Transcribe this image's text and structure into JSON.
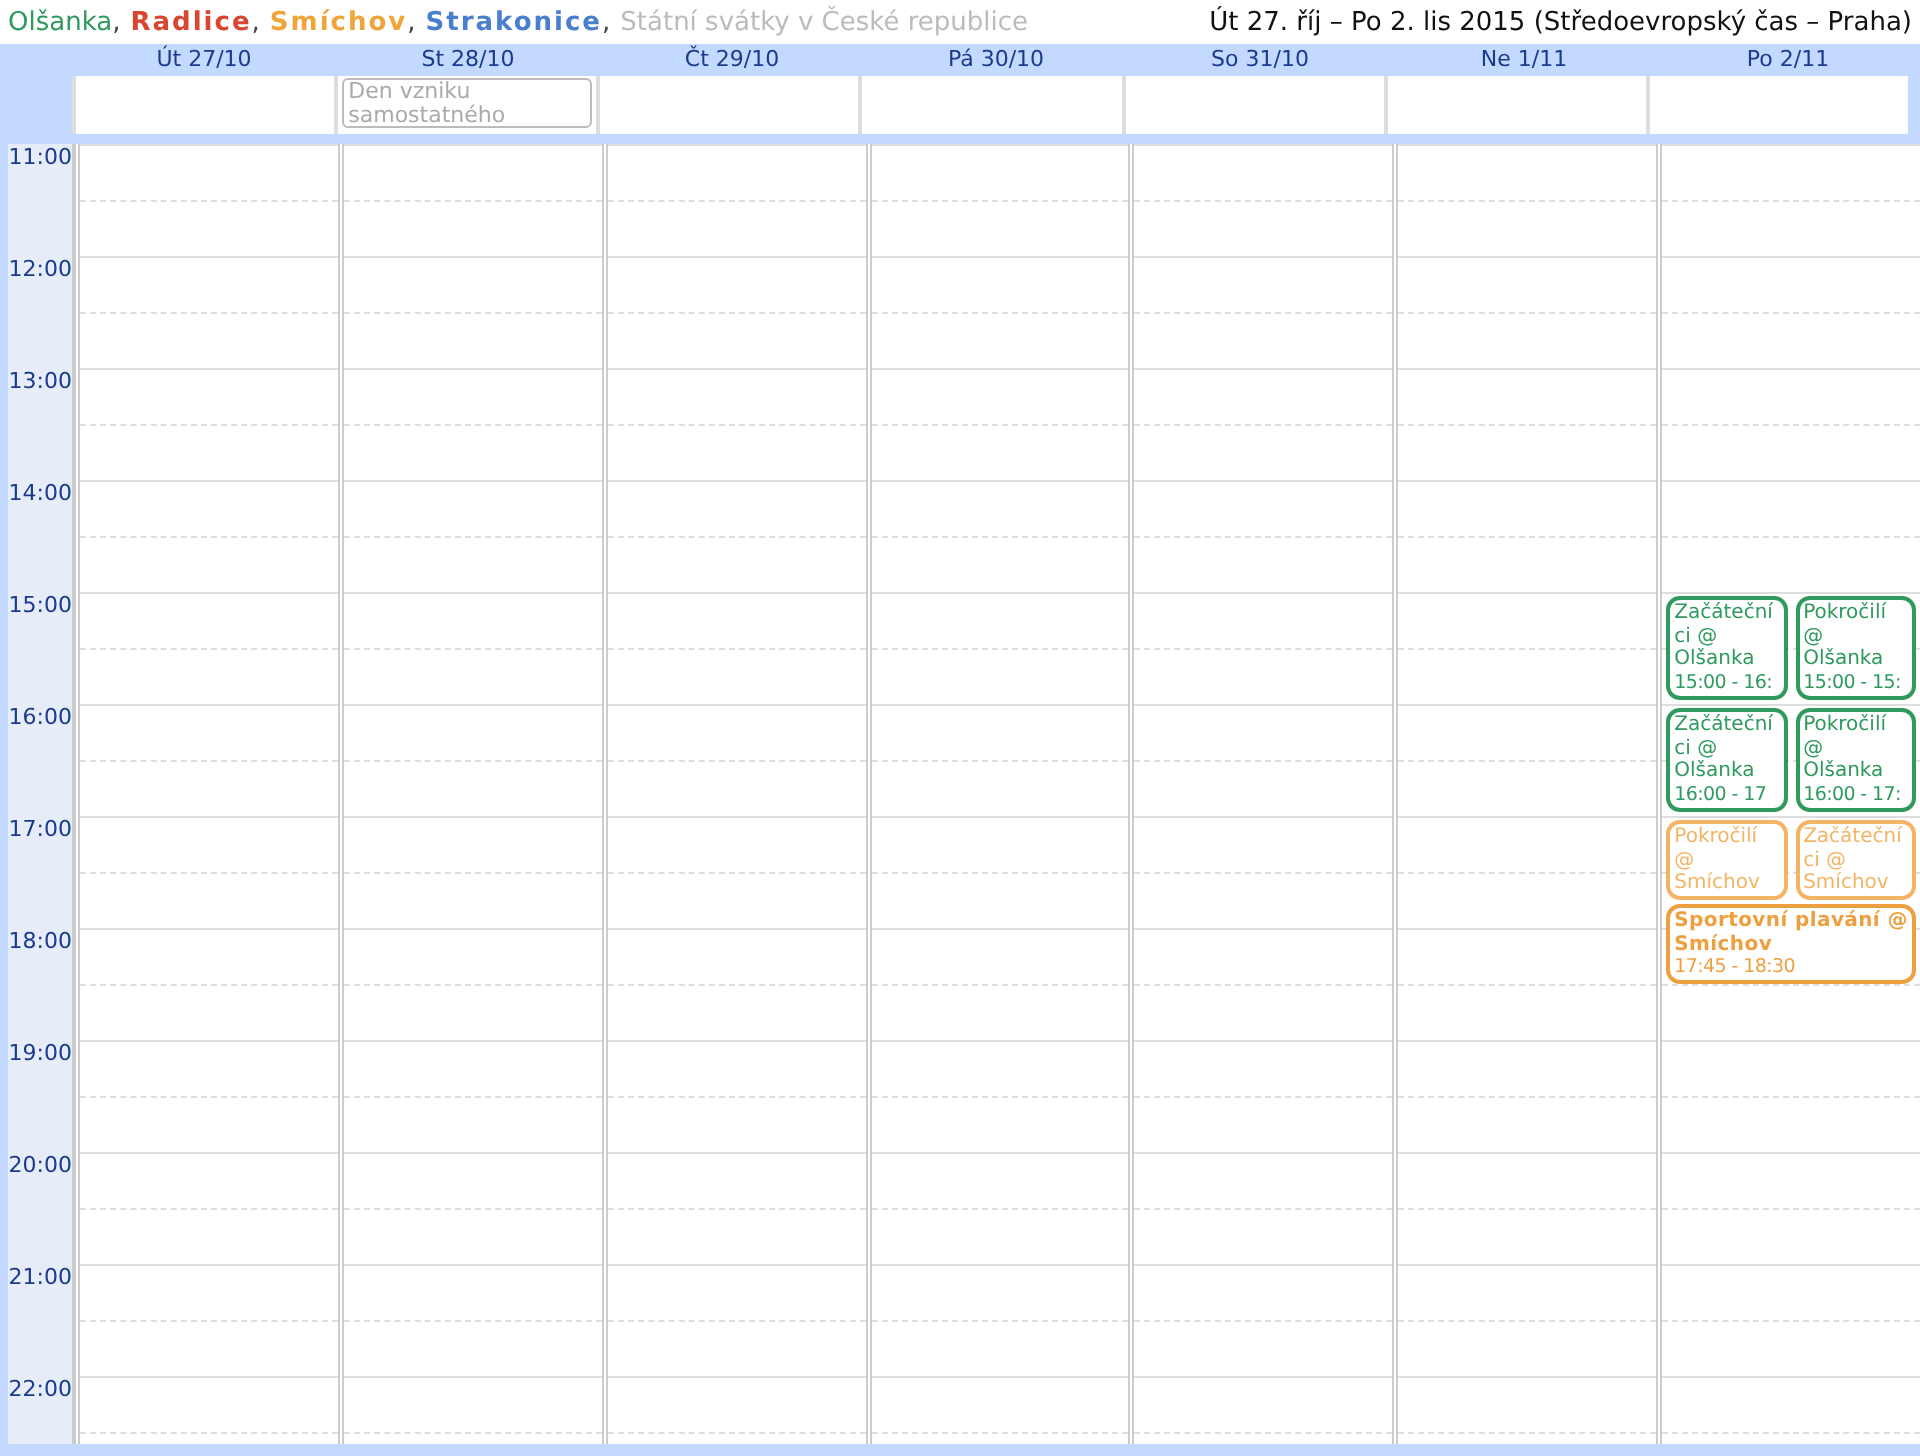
{
  "calendars": [
    {
      "name": "Olšanka",
      "suffix": ",",
      "color": "#2e9a5e",
      "bold": false
    },
    {
      "name": "Radlice",
      "suffix": ",",
      "color": "#d9452f",
      "bold": true
    },
    {
      "name": "Smíchov",
      "suffix": ",",
      "color": "#f0a53a",
      "bold": true
    },
    {
      "name": "Strakonice",
      "suffix": ",",
      "color": "#4a7fcf",
      "bold": true
    },
    {
      "name": "Státní svátky v České republice",
      "color": "#bbbbbb",
      "bold": false
    }
  ],
  "date_range": "Út 27. říj – Po 2. lis 2015 (Středoevropský čas – Praha)",
  "days": [
    {
      "label": "Út 27/10"
    },
    {
      "label": "St 28/10",
      "all_day": [
        "Den vzniku samostatného"
      ]
    },
    {
      "label": "Čt 29/10"
    },
    {
      "label": "Pá 30/10"
    },
    {
      "label": "So 31/10"
    },
    {
      "label": "Ne 1/11"
    },
    {
      "label": "Po 2/11",
      "event_rows": [
        [
          {
            "title": "Začáteční ci @ Olšanka",
            "time": "15:00 - 16:",
            "color": "#2e9a5e",
            "bold": false
          },
          {
            "title": "Pokročilí @ Olšanka",
            "time": "15:00 - 15:",
            "color": "#2e9a5e",
            "bold": false
          }
        ],
        [
          {
            "title": "Začáteční ci @ Olšanka",
            "time": "16:00 - 17",
            "color": "#2e9a5e",
            "bold": false
          },
          {
            "title": "Pokročilí @ Olšanka",
            "time": "16:00 - 17:",
            "color": "#2e9a5e",
            "bold": false
          }
        ],
        [
          {
            "title": "Pokročilí @ Smíchov",
            "color": "#f3b565",
            "bold": false
          },
          {
            "title": "Začáteční ci @ Smíchov",
            "color": "#f3b565",
            "bold": false
          }
        ],
        [
          {
            "title": "Sportovní plavání @ Smíchov",
            "time": "17:45 - 18:30",
            "color": "#eea040",
            "bold": true
          }
        ]
      ]
    }
  ],
  "hours": [
    "11:00",
    "12:00",
    "13:00",
    "14:00",
    "15:00",
    "16:00",
    "17:00",
    "18:00",
    "19:00",
    "20:00",
    "21:00",
    "22:00"
  ]
}
